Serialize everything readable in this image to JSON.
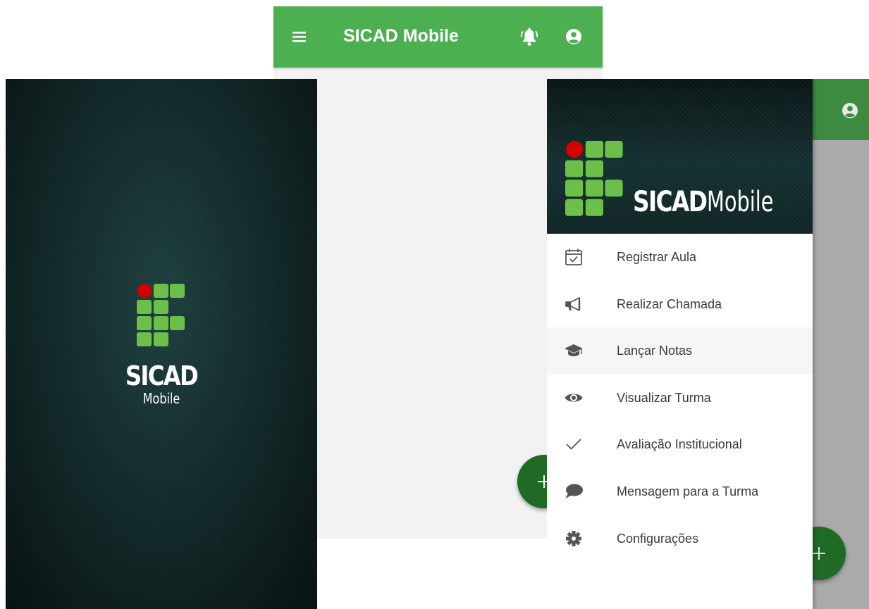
{
  "app": {
    "title": "SICAD Mobile"
  },
  "splash": {
    "title": "SICAD",
    "subtitle": "Mobile"
  },
  "drawer": {
    "brand_bold": "SICAD",
    "brand_light": "Mobile",
    "items": [
      {
        "label": "Registrar Aula",
        "icon": "calendar-check-icon"
      },
      {
        "label": "Realizar Chamada",
        "icon": "megaphone-icon"
      },
      {
        "label": "Lançar Notas",
        "icon": "graduation-cap-icon"
      },
      {
        "label": "Visualizar Turma",
        "icon": "eye-icon"
      },
      {
        "label": "Avaliação Institucional",
        "icon": "checkmark-icon"
      },
      {
        "label": "Mensagem para a Turma",
        "icon": "chat-bubble-icon"
      },
      {
        "label": "Configurações",
        "icon": "gear-icon"
      }
    ],
    "active_item": "Lançar Notas"
  },
  "colors": {
    "primary": "#4caf50",
    "fab": "#1f6a25",
    "logo_green": "#6cc04a",
    "logo_red": "#d40000",
    "splash_bg": "#112828"
  },
  "icons": {
    "menu": "hamburger-menu-icon",
    "notifications": "notification-bell-icon",
    "account": "account-circle-icon",
    "fab": "plus-icon"
  }
}
